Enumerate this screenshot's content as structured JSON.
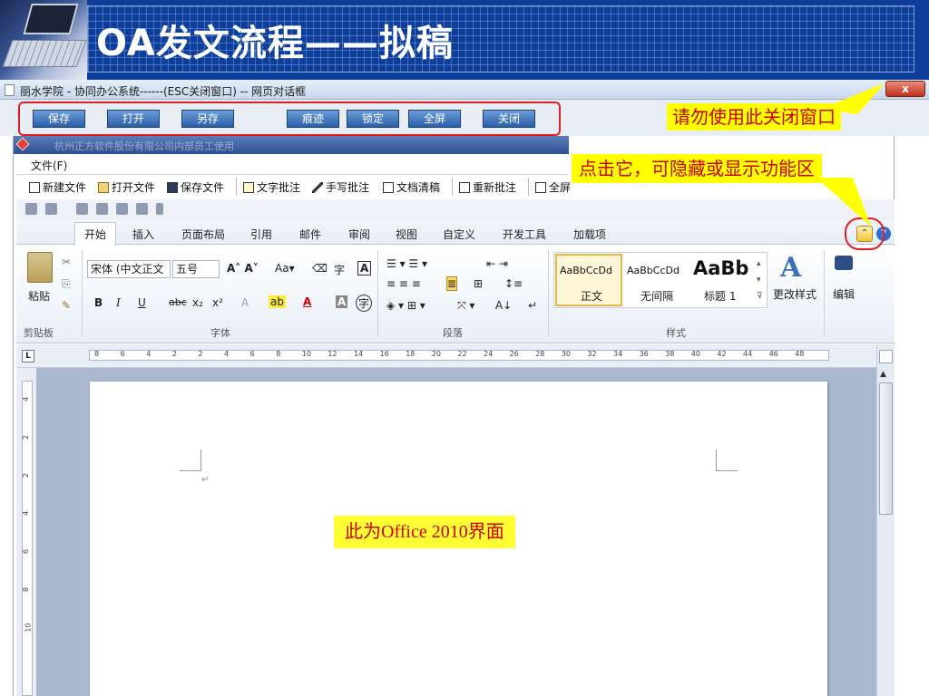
{
  "slide": {
    "title": "OA发文流程——拟稿"
  },
  "dialog": {
    "title": "丽水学院 - 协同办公系统------(ESC关闭窗口) -- 网页对话框",
    "close_symbol": "x"
  },
  "toolbar": {
    "buttons": [
      "保存",
      "打开",
      "另存",
      "痕迹",
      "锁定",
      "全屏",
      "关闭"
    ]
  },
  "control": {
    "caption": "杭州正方软件股份有限公司内部员工使用"
  },
  "menu": {
    "file": "文件(F)"
  },
  "commands": {
    "new": "新建文件",
    "open": "打开文件",
    "save": "保存文件",
    "text_note": "文字批注",
    "hand_note": "手写批注",
    "clean": "文档清稿",
    "reannotate": "重新批注",
    "fullscreen": "全屏"
  },
  "ribbon": {
    "tabs": [
      "开始",
      "插入",
      "页面布局",
      "引用",
      "邮件",
      "审阅",
      "视图",
      "自定义",
      "开发工具",
      "加载项"
    ],
    "active_tab": "开始",
    "paste": "粘贴",
    "font_name": "宋体 (中文正文",
    "font_size": "五号",
    "groups": [
      "剪贴板",
      "字体",
      "段落",
      "样式"
    ],
    "styles": [
      {
        "sample": "AaBbCcDd",
        "name": "正文"
      },
      {
        "sample": "AaBbCcDd",
        "name": "无间隔"
      },
      {
        "sample": "AaBb",
        "name": "标题 1"
      }
    ],
    "change_styles": "更改样式",
    "edit": "编辑"
  },
  "ruler": {
    "h_ticks": [
      "8",
      "6",
      "4",
      "2",
      "2",
      "4",
      "6",
      "8",
      "10",
      "12",
      "14",
      "16",
      "18",
      "20",
      "22",
      "24",
      "26",
      "28",
      "30",
      "32",
      "34",
      "36",
      "38",
      "40",
      "42",
      "44",
      "46",
      "48"
    ],
    "v_ticks": [
      "4",
      "2",
      "2",
      "4",
      "6",
      "8",
      "10"
    ]
  },
  "annotations": {
    "close_warning": "请勿使用此关闭窗口",
    "ribbon_toggle_hint": "点击它，可隐藏或显示功能区",
    "office_note": "此为Office 2010界面"
  },
  "colors": {
    "header_blue": "#0d3e9a",
    "callout_yellow": "#ffff00",
    "callout_text_red": "#cc0000",
    "highlight_red": "#e02020",
    "toolbar_button_blue": "#2a5ea8"
  }
}
